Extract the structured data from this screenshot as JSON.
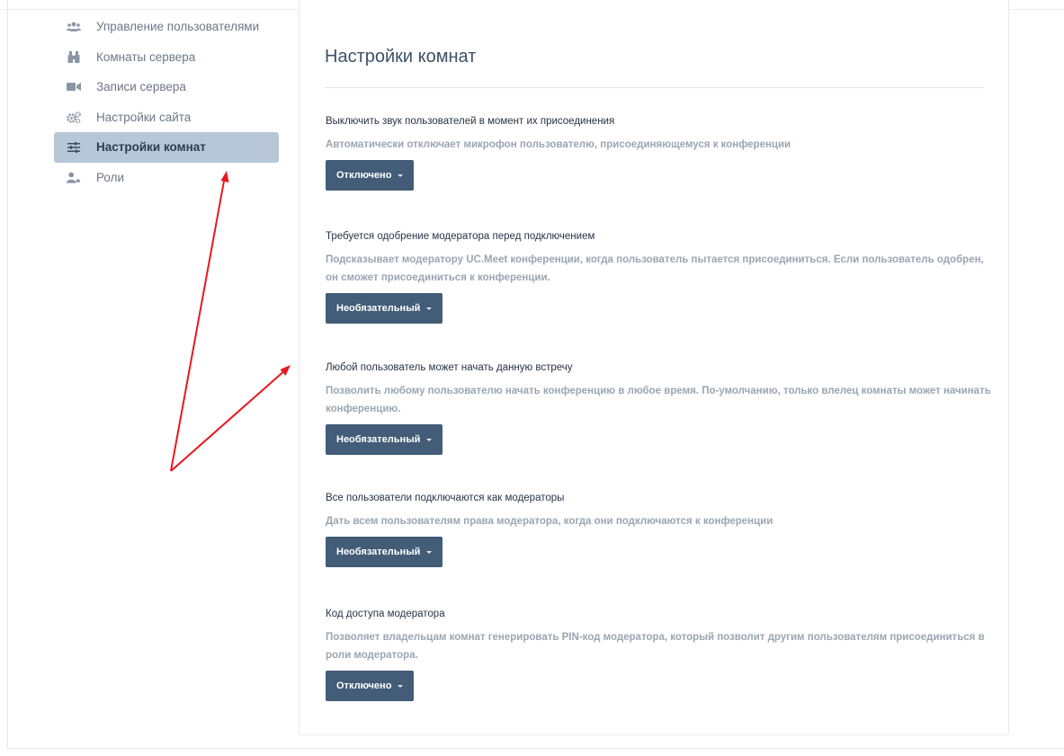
{
  "sidebar": {
    "items": [
      {
        "label": "Управление пользователями",
        "icon": "users-icon",
        "active": false
      },
      {
        "label": "Комнаты сервера",
        "icon": "binoculars-icon",
        "active": false
      },
      {
        "label": "Записи сервера",
        "icon": "video-camera-icon",
        "active": false
      },
      {
        "label": "Настройки сайта",
        "icon": "cogs-icon",
        "active": false
      },
      {
        "label": "Настройки комнат",
        "icon": "sliders-icon",
        "active": true
      },
      {
        "label": "Роли",
        "icon": "user-role-icon",
        "active": false
      }
    ]
  },
  "main": {
    "title": "Настройки комнат",
    "settings": [
      {
        "title": "Выключить звук пользователей в момент их присоединения",
        "description": "Автоматически отключает микрофон пользователю, присоединяющемуся к конференции",
        "value": "Отключено"
      },
      {
        "title": "Требуется одобрение модератора перед подключением",
        "description": "Подсказывает модератору UC.Meet конференции, когда пользователь пытается присоединиться. Если пользователь одобрен, он сможет присоединиться к конференции.",
        "value": "Необязательный"
      },
      {
        "title": "Любой пользователь может начать данную встречу",
        "description": "Позволить любому пользователю начать конференцию в любое время. По-умолчанию, только влелец комнаты может начинать конференцию.",
        "value": "Необязательный"
      },
      {
        "title": "Все пользователи подключаются как модераторы",
        "description": "Дать всем пользователям права модератора, когда они подключаются к конференции",
        "value": "Необязательный"
      },
      {
        "title": "Код доступа модератора",
        "description": "Позволяет владельцам комнат генерировать PIN-код модератора, который позволит другим пользователям присоединиться в роли модератора.",
        "value": "Отключено"
      }
    ]
  },
  "colors": {
    "accent_button": "#435c78",
    "sidebar_active": "#b7c7d8",
    "annotation_arrow": "#e8181e"
  }
}
